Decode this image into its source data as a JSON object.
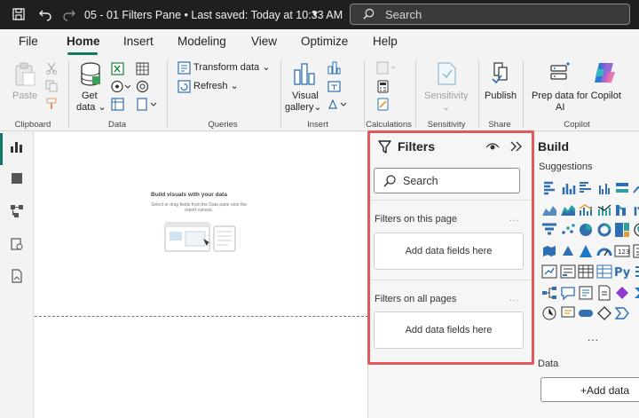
{
  "titlebar": {
    "title": "05 - 01 Filters Pane • Last saved: Today at 10:33 AM",
    "search_placeholder": "Search"
  },
  "menu": {
    "tabs": [
      "File",
      "Home",
      "Insert",
      "Modeling",
      "View",
      "Optimize",
      "Help"
    ],
    "active": "Home"
  },
  "ribbon": {
    "clipboard": {
      "paste": "Paste",
      "group": "Clipboard"
    },
    "data": {
      "get_data": "Get data",
      "get_data_line1": "Get",
      "get_data_line2": "data",
      "group": "Data"
    },
    "queries": {
      "transform": "Transform data",
      "refresh": "Refresh",
      "group": "Queries"
    },
    "insert": {
      "visual_gallery_line1": "Visual",
      "visual_gallery_line2": "gallery",
      "group": "Insert"
    },
    "calculations": {
      "group": "Calculations"
    },
    "sensitivity": {
      "label": "Sensitivity",
      "group": "Sensitivity"
    },
    "share": {
      "publish": "Publish",
      "group": "Share"
    },
    "copilot": {
      "prep_line1": "Prep data for Copilot",
      "prep_line2": "AI",
      "group": "Copilot"
    }
  },
  "canvas": {
    "hint_title": "Build visuals with your data",
    "hint_text": "Select or drag fields from the Data pane onto the report canvas."
  },
  "filters": {
    "title": "Filters",
    "search_placeholder": "Search",
    "on_this_page": "Filters on this page",
    "on_all_pages": "Filters on all pages",
    "well_this_page": "Add data fields here",
    "well_all_pages": "Add data fields here",
    "more": "..."
  },
  "build": {
    "title": "Build",
    "suggestions": "Suggestions",
    "data_label": "Data",
    "add_data": "+Add data",
    "more_visuals": "..."
  },
  "colors": {
    "accent": "#117865",
    "highlight": "#e2595b",
    "titlebar": "#1f1f1f",
    "icon_blue": "#2f6fb2"
  }
}
